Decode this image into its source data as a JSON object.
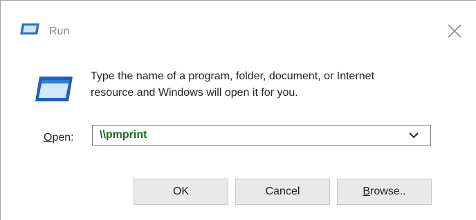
{
  "window": {
    "title": "Run",
    "icon": "run-dialog-icon",
    "close_icon": "close-icon"
  },
  "message": {
    "line1": "Type the name of a program, folder, document, or Internet",
    "line2": "resource and Windows will open it for you."
  },
  "open_field": {
    "label_accel": "O",
    "label_rest": "pen:",
    "value": "\\\\pmprint",
    "dropdown_icon": "chevron-down-icon"
  },
  "buttons": {
    "ok": "OK",
    "cancel": "Cancel",
    "browse_accel": "B",
    "browse_rest": "rowse.."
  },
  "colors": {
    "input_text": "#196b1c",
    "title_text": "#8a8a8a",
    "button_bg": "#e9e9e9"
  }
}
